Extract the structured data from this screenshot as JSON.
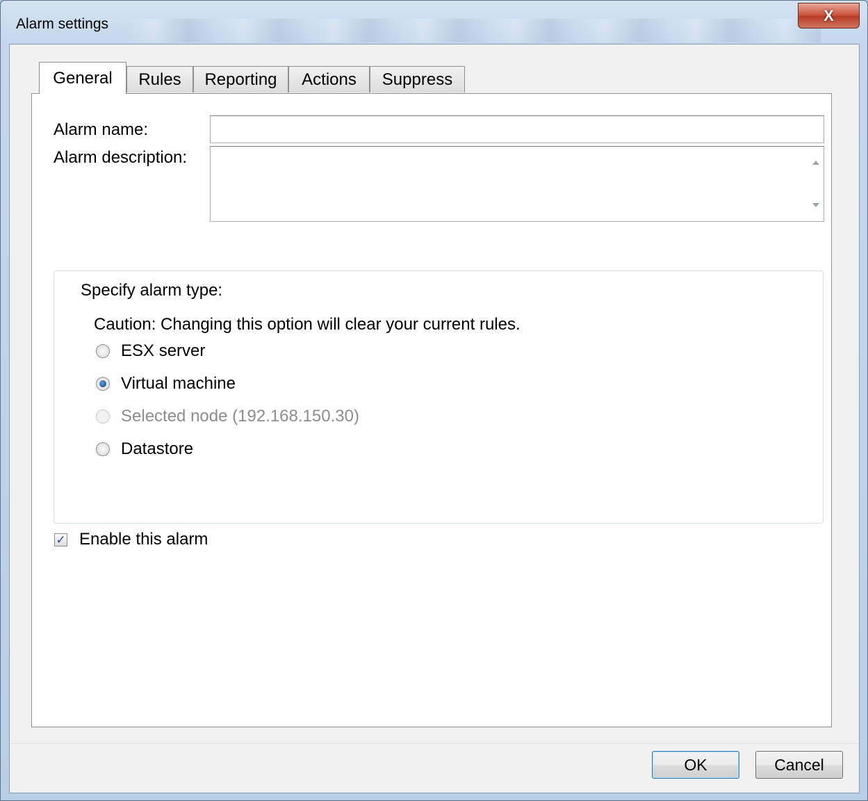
{
  "window": {
    "title": "Alarm settings",
    "close_glyph": "X"
  },
  "tabs": [
    {
      "label": "General",
      "active": true
    },
    {
      "label": "Rules",
      "active": false
    },
    {
      "label": "Reporting",
      "active": false
    },
    {
      "label": "Actions",
      "active": false
    },
    {
      "label": "Suppress",
      "active": false
    }
  ],
  "general": {
    "alarm_name_label": "Alarm name:",
    "alarm_name_value": "",
    "alarm_description_label": "Alarm description:",
    "alarm_description_value": "",
    "alarm_type": {
      "heading": "Specify alarm type:",
      "caution": "Caution: Changing this option will clear your current rules.",
      "options": [
        {
          "label": "ESX server",
          "checked": false,
          "disabled": false
        },
        {
          "label": "Virtual machine",
          "checked": true,
          "disabled": false
        },
        {
          "label": "Selected node (192.168.150.30)",
          "checked": false,
          "disabled": true
        },
        {
          "label": "Datastore",
          "checked": false,
          "disabled": false
        }
      ]
    },
    "enable_alarm_label": "Enable this alarm",
    "enable_alarm_checked": true
  },
  "buttons": {
    "ok_label": "OK",
    "cancel_label": "Cancel"
  }
}
